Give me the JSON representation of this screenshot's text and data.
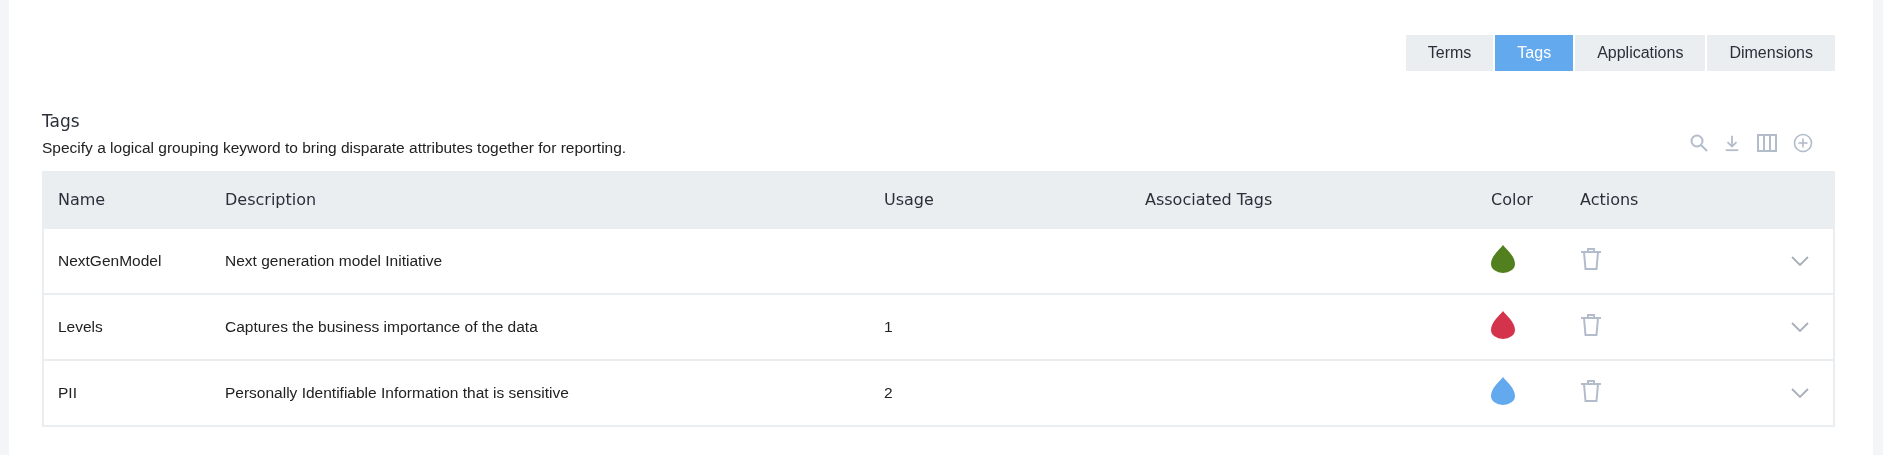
{
  "tabs": [
    {
      "label": "Terms",
      "selected": false
    },
    {
      "label": "Tags",
      "selected": true
    },
    {
      "label": "Applications",
      "selected": false
    },
    {
      "label": "Dimensions",
      "selected": false
    }
  ],
  "section": {
    "title": "Tags",
    "description": "Specify a logical grouping keyword to bring disparate attributes together for reporting."
  },
  "table": {
    "columns": [
      "Name",
      "Description",
      "Usage",
      "Associated Tags",
      "Color",
      "Actions"
    ],
    "rows": [
      {
        "name": "NextGenModel",
        "description": "Next generation model Initiative",
        "color": "#53801f"
      },
      {
        "name": "Levels",
        "description": "Captures the business importance of the data",
        "usage": "1",
        "color": "#d4334c"
      },
      {
        "name": "PII",
        "description": "Personally Identifiable Information that is sensitive",
        "usage": "2",
        "color": "#63a9ee"
      }
    ]
  }
}
